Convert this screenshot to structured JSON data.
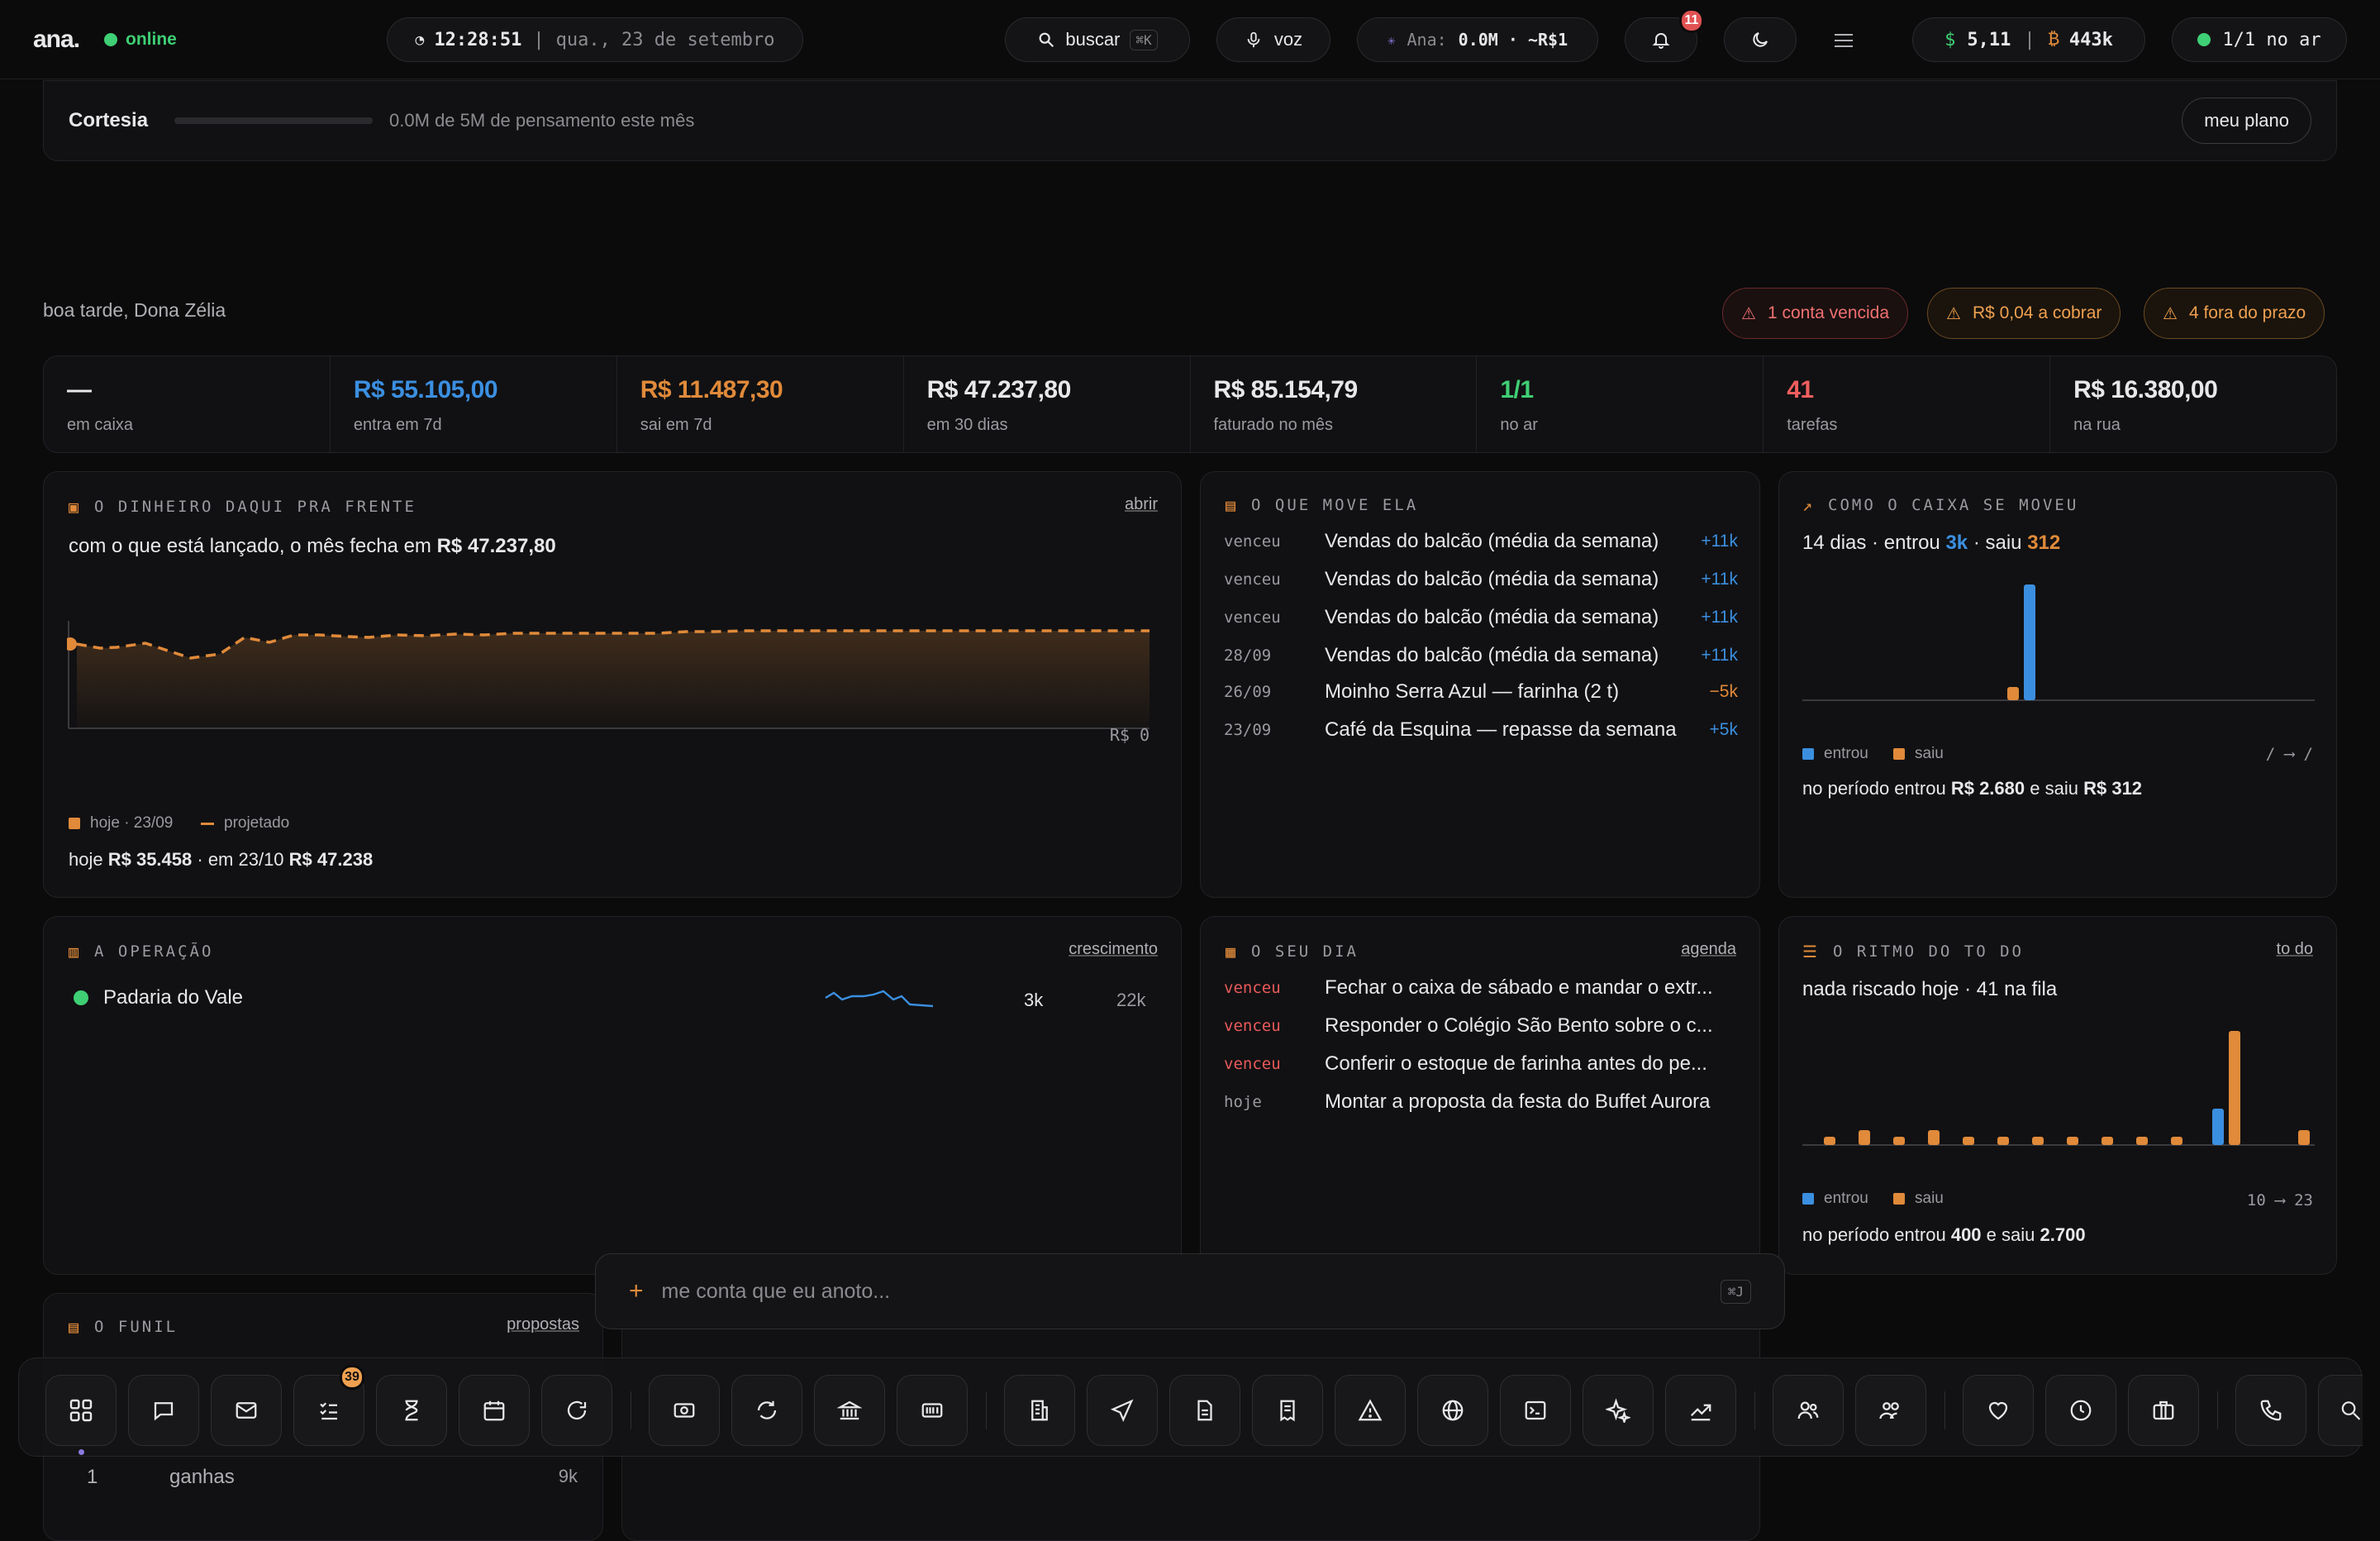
{
  "topbar": {
    "logo": "ana.",
    "status": "online",
    "time": "12:28:51",
    "date": "qua., 23 de setembro",
    "search_label": "buscar",
    "search_kbd": "⌘K",
    "voice_label": "voz",
    "ana_label": "Ana:",
    "ana_value": "0.0M · ~R$1",
    "notifications_count": "11",
    "balance_usd": "5,11",
    "balance_btc": "443k",
    "air_status": "1/1 no ar"
  },
  "plan": {
    "title": "Cortesia",
    "usage_text": "0.0M de 5M de pensamento este mês",
    "usage_fraction": 0.0,
    "button": "meu plano"
  },
  "greeting": "boa tarde, Dona Zélia",
  "alerts": [
    {
      "label": "1 conta vencida"
    },
    {
      "label": "R$ 0,04 a cobrar"
    },
    {
      "label": "4 fora do prazo"
    }
  ],
  "kpis": [
    {
      "value": "—",
      "label": "em caixa"
    },
    {
      "value": "R$ 55.105,00",
      "label": "entra em 7d"
    },
    {
      "value": "R$ 11.487,30",
      "label": "sai em 7d"
    },
    {
      "value": "R$ 47.237,80",
      "label": "em 30 dias"
    },
    {
      "value": "R$ 85.154,79",
      "label": "faturado no mês"
    },
    {
      "value": "1/1",
      "label": "no ar"
    },
    {
      "value": "41",
      "label": "tarefas"
    },
    {
      "value": "R$ 16.380,00",
      "label": "na rua"
    }
  ],
  "forecast": {
    "section": "O DINHEIRO DAQUI PRA FRENTE",
    "link": "abrir",
    "headline_pre": "com o que está lançado, o mês fecha em",
    "headline_value": "R$ 47.237,80",
    "axis_label": "R$ 0",
    "legend_today": "hoje · 23/09",
    "legend_projected": "projetado",
    "footer_pre": "hoje",
    "footer_today": "R$ 35.458",
    "footer_mid": "· em 23/10",
    "footer_end": "R$ 47.238"
  },
  "movers": {
    "section": "O QUE MOVE ELA",
    "rows": [
      {
        "date": "venceu",
        "name": "Vendas do balcão (média da semana)",
        "amount": "+11k"
      },
      {
        "date": "venceu",
        "name": "Vendas do balcão (média da semana)",
        "amount": "+11k"
      },
      {
        "date": "venceu",
        "name": "Vendas do balcão (média da semana)",
        "amount": "+11k"
      },
      {
        "date": "28/09",
        "name": "Vendas do balcão (média da semana)",
        "amount": "+11k"
      },
      {
        "date": "26/09",
        "name": "Moinho Serra Azul — farinha (2 t)",
        "amount": "−5k"
      },
      {
        "date": "23/09",
        "name": "Café da Esquina — repasse da semana",
        "amount": "+5k"
      }
    ]
  },
  "cashflow": {
    "section": "COMO O CAIXA SE MOVEU",
    "head_pre": "14 dias · entrou",
    "head_in": "3k",
    "head_mid": "· saiu",
    "head_out": "312",
    "legend_in": "entrou",
    "legend_out": "saiu",
    "range": "/ ⟶ /",
    "footer_pre": "no período entrou",
    "footer_in": "R$ 2.680",
    "footer_mid": "e saiu",
    "footer_out": "R$ 312"
  },
  "operation": {
    "section": "A OPERAÇÃO",
    "link": "crescimento",
    "name": "Padaria do Vale",
    "v1": "3k",
    "v2": "22k"
  },
  "day": {
    "section": "O SEU DIA",
    "link": "agenda",
    "rows": [
      {
        "date": "venceu",
        "name": "Fechar o caixa de sábado e mandar o extr..."
      },
      {
        "date": "venceu",
        "name": "Responder o Colégio São Bento sobre o c..."
      },
      {
        "date": "venceu",
        "name": "Conferir o estoque de farinha antes do pe..."
      },
      {
        "date": "hoje",
        "name": "Montar a proposta da festa do Buffet Aurora"
      }
    ]
  },
  "todo": {
    "section": "O RITMO DO TO DO",
    "link": "to do",
    "head": "nada riscado hoje · 41 na fila",
    "legend_in": "entrou",
    "legend_out": "saiu",
    "range": "10 ⟶ 23",
    "footer_pre": "no período entrou",
    "footer_in": "400",
    "footer_mid": "e saiu",
    "footer_out": "2.700"
  },
  "funnel": {
    "section": "O FUNIL",
    "link": "propostas",
    "last_row_n": "1",
    "last_row_label": "ganhas",
    "last_row_value": "9k"
  },
  "input": {
    "placeholder": "me conta que eu anoto...",
    "kbd": "⌘J"
  },
  "dock": {
    "tasks_badge": "39"
  }
}
